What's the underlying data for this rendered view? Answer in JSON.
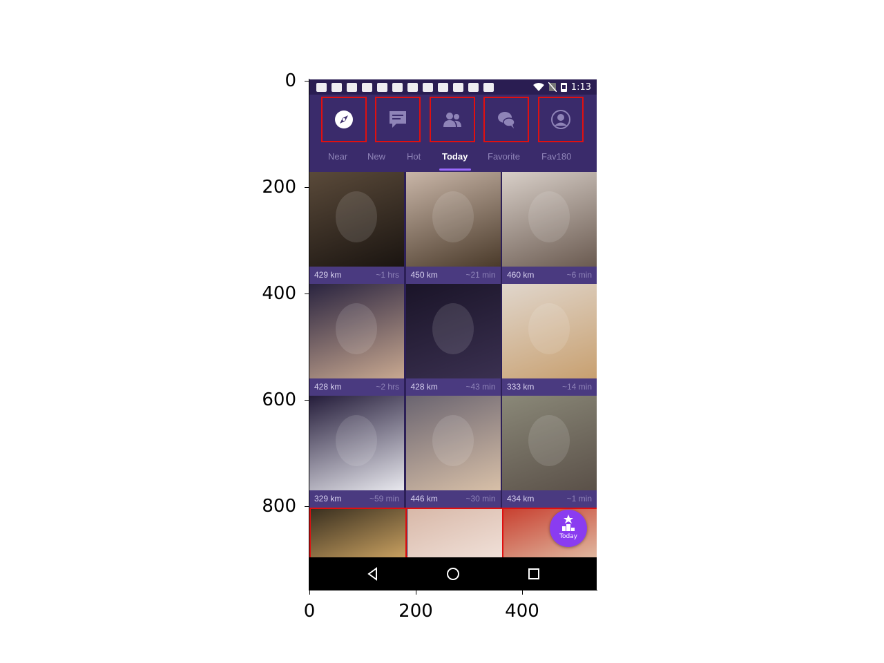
{
  "axes": {
    "y_ticks": [
      "0",
      "200",
      "400",
      "600",
      "800"
    ],
    "x_ticks": [
      "0",
      "200",
      "400"
    ]
  },
  "status_bar": {
    "time": "1:13",
    "notification_icons": [
      "chat-icon",
      "wrench-icon",
      "message-icon",
      "phone-msg-icon",
      "edit-icon",
      "facebook-icon",
      "menu-icon",
      "ib-icon",
      "facebook-icon",
      "b-icon",
      "power-icon",
      "mute-icon"
    ],
    "status_icons": [
      "wifi-icon",
      "no-sim-icon",
      "battery-icon"
    ]
  },
  "top_nav": {
    "buttons": [
      {
        "icon": "compass-icon",
        "name": "nav-discover"
      },
      {
        "icon": "chat-bubble-icon",
        "name": "nav-messages"
      },
      {
        "icon": "people-icon",
        "name": "nav-friends"
      },
      {
        "icon": "chat-bubbles-icon",
        "name": "nav-chats"
      },
      {
        "icon": "profile-icon",
        "name": "nav-profile"
      }
    ]
  },
  "tabs": [
    "Near",
    "New",
    "Hot",
    "Today",
    "Favorite",
    "Fav180"
  ],
  "active_tab": "Today",
  "grid": [
    {
      "distance": "429 km",
      "time": "~1 hrs",
      "colors": [
        "#5a4a3a",
        "#1a1410"
      ]
    },
    {
      "distance": "450 km",
      "time": "~21 min",
      "colors": [
        "#c9b6a8",
        "#4a3a2a"
      ]
    },
    {
      "distance": "460 km",
      "time": "~6 min",
      "colors": [
        "#d8cfc8",
        "#6a5a50"
      ]
    },
    {
      "distance": "428 km",
      "time": "~2 hrs",
      "colors": [
        "#2a2440",
        "#c8a890"
      ]
    },
    {
      "distance": "428 km",
      "time": "~43 min",
      "colors": [
        "#1a1428",
        "#3a3050"
      ]
    },
    {
      "distance": "333 km",
      "time": "~14 min",
      "colors": [
        "#e0d6cc",
        "#c8a070"
      ]
    },
    {
      "distance": "329 km",
      "time": "~59 min",
      "colors": [
        "#241c3a",
        "#e8e8ee"
      ]
    },
    {
      "distance": "446 km",
      "time": "~30 min",
      "colors": [
        "#6a6470",
        "#d8c0a8"
      ]
    },
    {
      "distance": "434 km",
      "time": "~1 min",
      "colors": [
        "#8a8878",
        "#5a5048"
      ]
    }
  ],
  "last_row_colors": [
    [
      "#3a3020",
      "#c8a060"
    ],
    [
      "#d8b8a8",
      "#f0e0d8"
    ],
    [
      "#c84030",
      "#e0b8a0"
    ]
  ],
  "fab": {
    "label": "Today",
    "icon": "podium-star-icon"
  },
  "system_nav": [
    "back-icon",
    "home-icon",
    "recents-icon"
  ]
}
